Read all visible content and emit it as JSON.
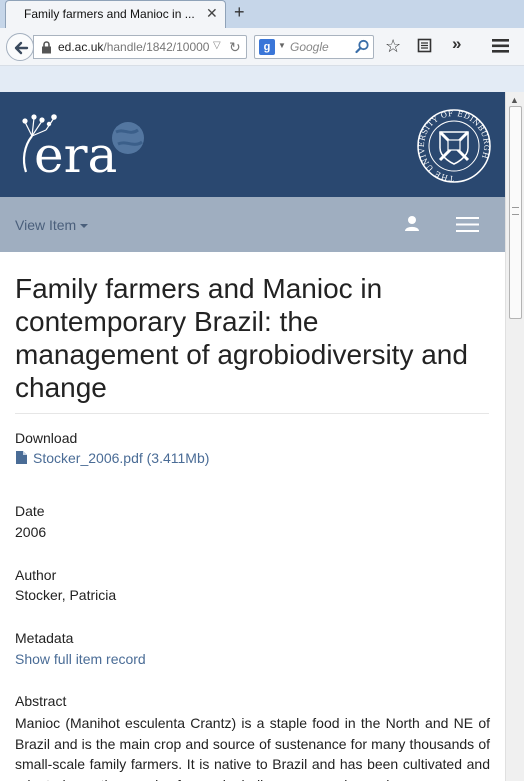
{
  "browser": {
    "tab_title": "Family farmers and Manioc in ...",
    "url_domain": "ed.ac.uk",
    "url_path": "/handle/1842/10000",
    "search_placeholder": "Google",
    "search_engine_letter": "g",
    "icons": [
      "back-icon",
      "lock-icon",
      "reload-icon",
      "search-icon",
      "bookmark-star-icon",
      "reader-icon",
      "overflow-icon",
      "menu-icon",
      "close-icon",
      "new-tab-icon"
    ]
  },
  "site": {
    "logo_text": "era",
    "crest_text": "THE UNIVERSITY OF EDINBURGH",
    "header_color": "#2a4870",
    "trail_color": "#9faec0",
    "link_color": "#4a6c96"
  },
  "trail": {
    "view_item_label": "View Item"
  },
  "item": {
    "title": "Family farmers and Manioc in contemporary Brazil: the management of agrobiodiversity and change",
    "download_label": "Download",
    "file_link": "Stocker_2006.pdf (3.411Mb)",
    "date_label": "Date",
    "date_value": "2006",
    "author_label": "Author",
    "author_value": "Stocker, Patricia",
    "metadata_label": "Metadata",
    "full_record_link": "Show full item record",
    "abstract_label": "Abstract",
    "abstract_text": "Manioc (Manihot esculenta Crantz) is a staple food in the North and NE of Brazil and is the main crop and source of sustenance for many thousands of small-scale family farmers. It is native to Brazil and has been cultivated and adapted over thousands of years by indigenous peoples and"
  }
}
